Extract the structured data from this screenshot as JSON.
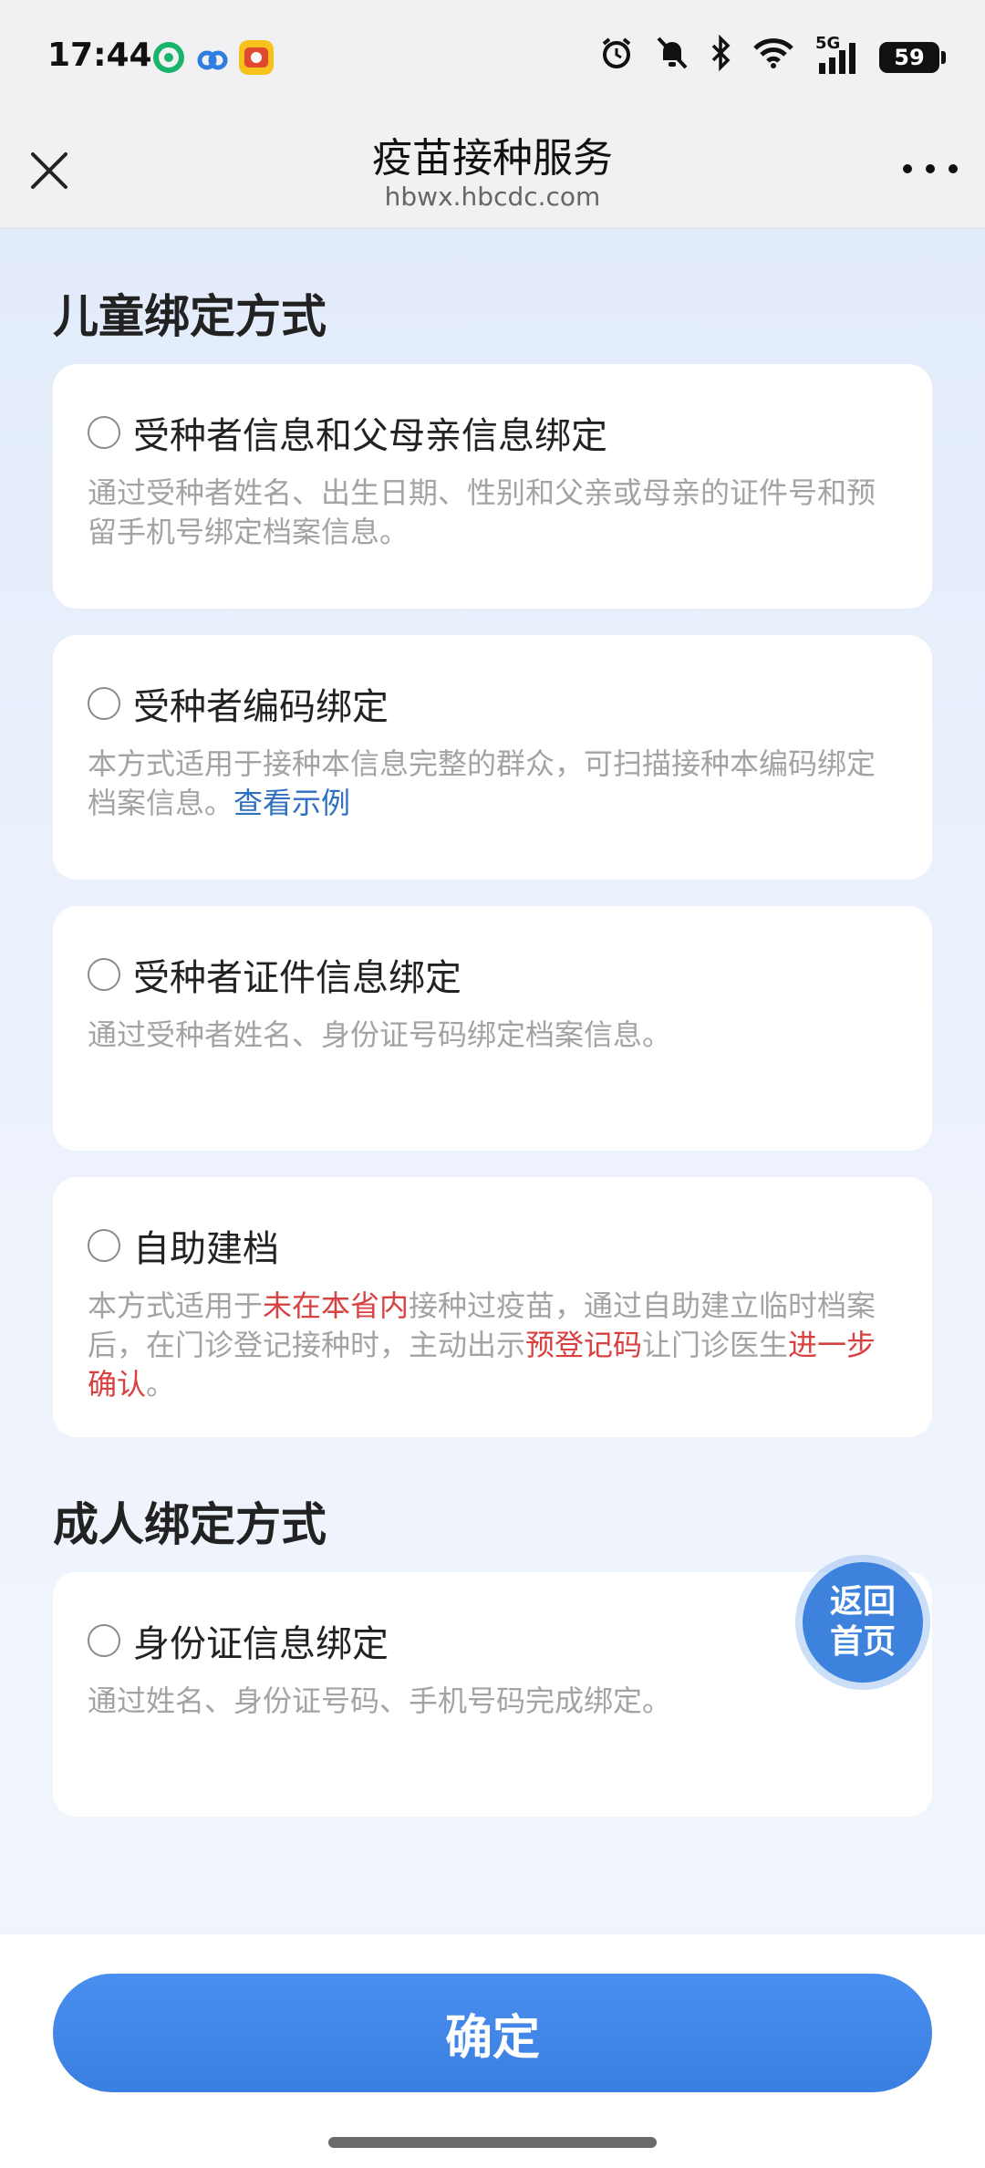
{
  "status_bar": {
    "time": "17:44",
    "network_label": "5G",
    "battery_level": "59",
    "icons": [
      "alarm-icon",
      "bell-off-icon",
      "bluetooth-icon",
      "wifi-icon",
      "signal-icon",
      "battery-icon"
    ]
  },
  "nav": {
    "title": "疫苗接种服务",
    "subtitle": "hbwx.hbcdc.com"
  },
  "children": {
    "section_title": "儿童绑定方式",
    "options": [
      {
        "title": "受种者信息和父母亲信息绑定",
        "desc": "通过受种者姓名、出生日期、性别和父亲或母亲的证件号和预留手机号绑定档案信息。"
      },
      {
        "title": "受种者编码绑定",
        "desc": "本方式适用于接种本信息完整的群众，可扫描接种本编码绑定档案信息。",
        "link": "查看示例"
      },
      {
        "title": "受种者证件信息绑定",
        "desc": "通过受种者姓名、身份证号码绑定档案信息。"
      },
      {
        "title": "自助建档",
        "desc_parts": [
          "本方式适用于",
          "未在本省内",
          "接种过疫苗，通过自助建立临时档案后，在门诊登记接种时，主动出示",
          "预登记码",
          "让门诊医生",
          "进一步确认",
          "。"
        ]
      }
    ]
  },
  "adult": {
    "section_title": "成人绑定方式",
    "options": [
      {
        "title": "身份证信息绑定",
        "desc": "通过姓名、身份证号码、手机号码完成绑定。"
      }
    ]
  },
  "home_button": {
    "line1": "返回",
    "line2": "首页"
  },
  "confirm_label": "确定",
  "colors": {
    "primary": "#3d83de",
    "link": "#2f6fc0",
    "highlight": "#d94040"
  }
}
